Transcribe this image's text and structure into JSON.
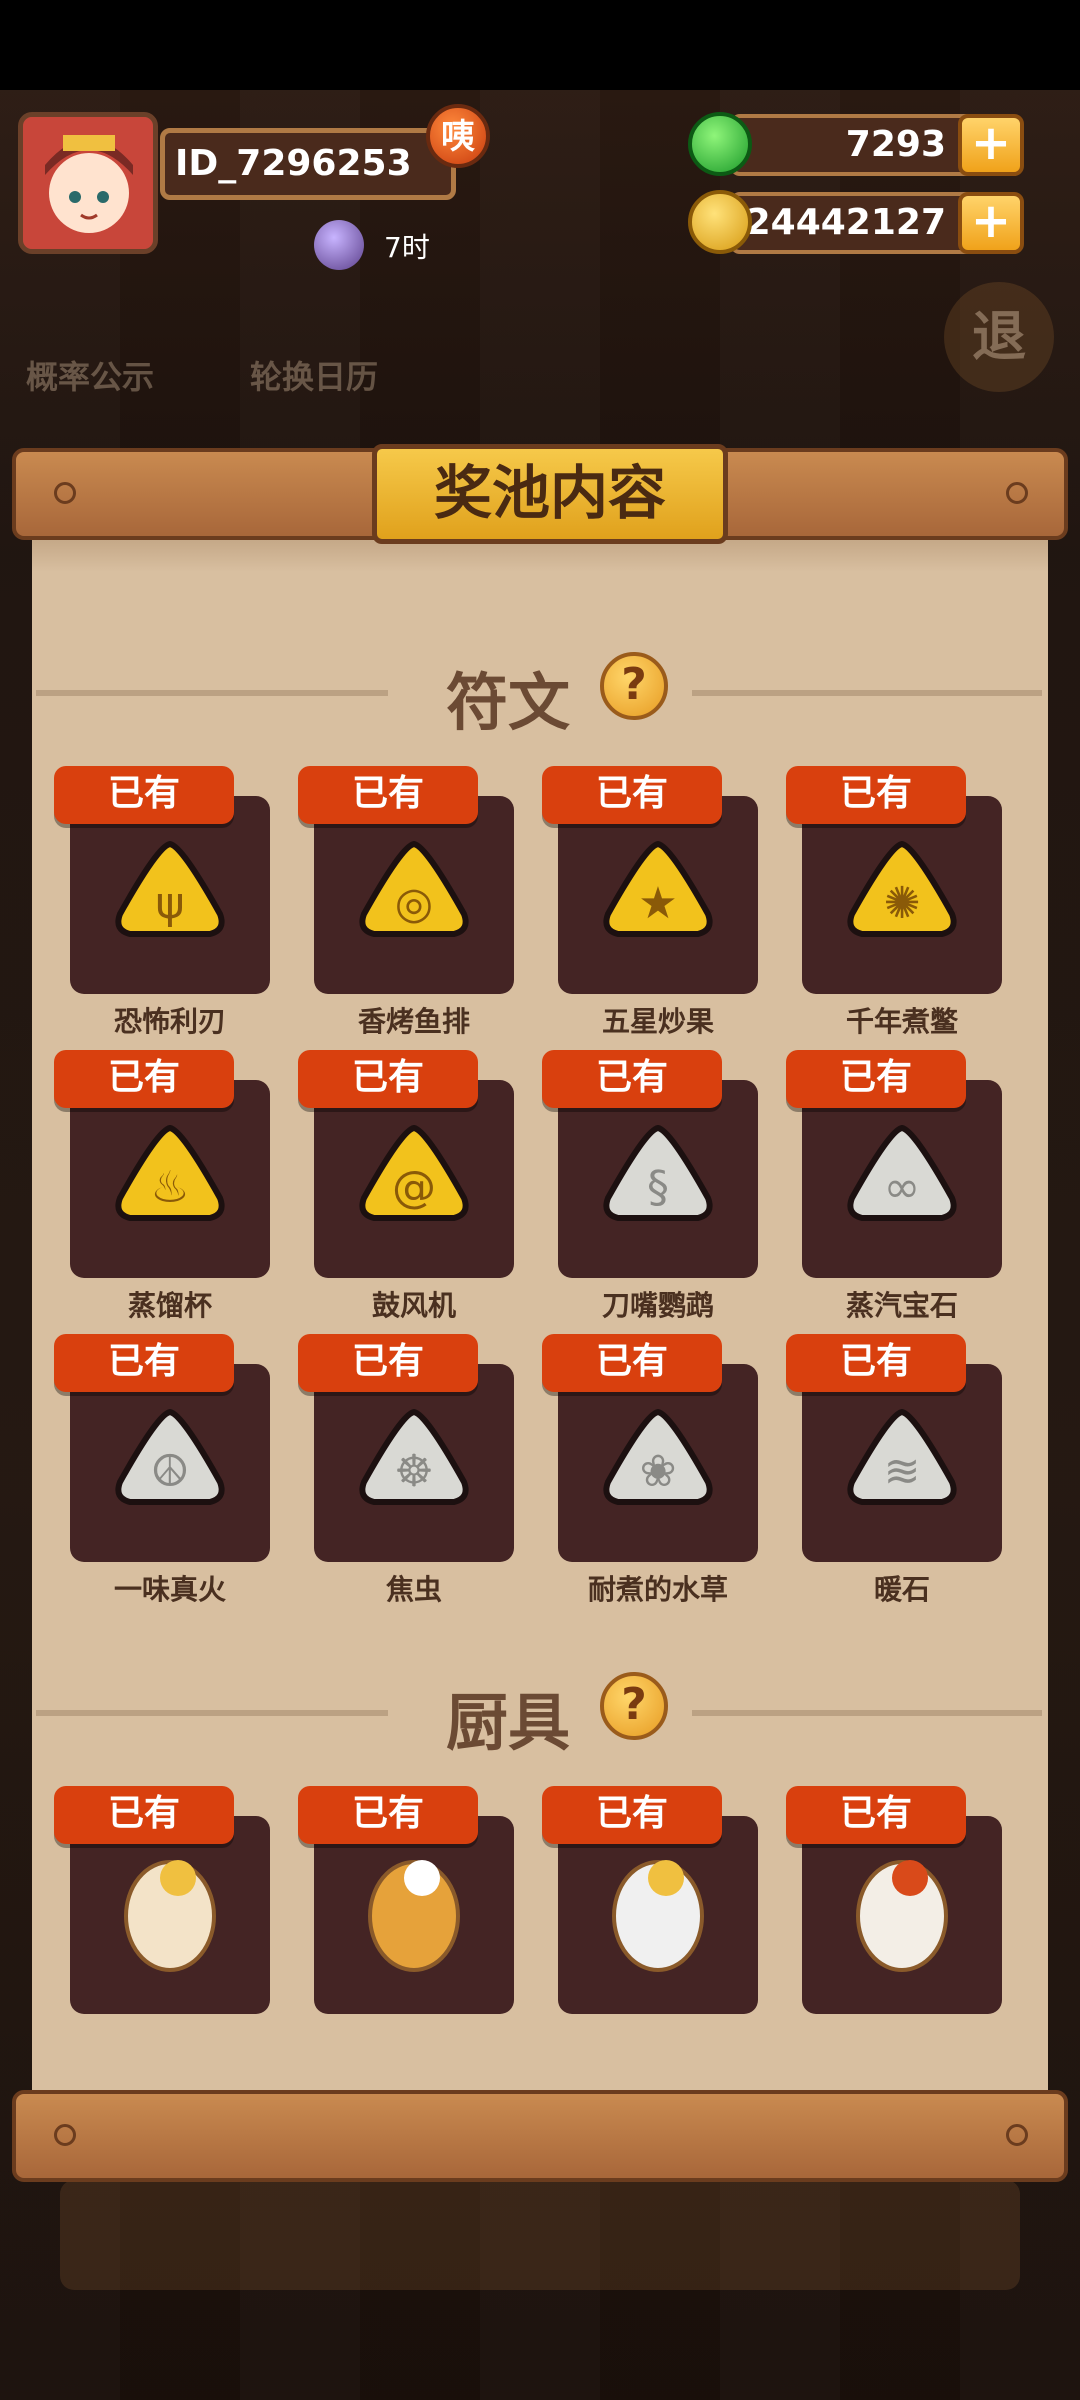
{
  "player": {
    "id": "ID_7296253",
    "badge": "咦",
    "time": "7时"
  },
  "currencies": {
    "jade": "7293",
    "coins": "24442127",
    "plus": "+"
  },
  "background_menu": {
    "rate": "概率公示",
    "calendar": "轮换日历",
    "exit": "退"
  },
  "panel": {
    "title": "奖池内容",
    "owned_tag": "已有",
    "help": "?",
    "sections": [
      {
        "title": "符文",
        "items": [
          {
            "name": "恐怖利刃",
            "tier": "gold",
            "glyph": "ψ"
          },
          {
            "name": "香烤鱼排",
            "tier": "gold",
            "glyph": "◎"
          },
          {
            "name": "五星炒果",
            "tier": "gold",
            "glyph": "★"
          },
          {
            "name": "千年煮鳖",
            "tier": "gold",
            "glyph": "✺"
          },
          {
            "name": "蒸馏杯",
            "tier": "gold",
            "glyph": "♨"
          },
          {
            "name": "鼓风机",
            "tier": "gold",
            "glyph": "@"
          },
          {
            "name": "刀嘴鹦鹉",
            "tier": "silver",
            "glyph": "§"
          },
          {
            "name": "蒸汽宝石",
            "tier": "silver",
            "glyph": "∞"
          },
          {
            "name": "一味真火",
            "tier": "silver",
            "glyph": "☮"
          },
          {
            "name": "焦虫",
            "tier": "silver",
            "glyph": "☸"
          },
          {
            "name": "耐煮的水草",
            "tier": "silver",
            "glyph": "❀"
          },
          {
            "name": "暖石",
            "tier": "silver",
            "glyph": "≋"
          }
        ]
      },
      {
        "title": "厨具",
        "items": [
          {
            "name": "",
            "icon": "dancing-lion-broom-icon"
          },
          {
            "name": "",
            "icon": "phoenix-duster-icon"
          },
          {
            "name": "",
            "icon": "unicorn-ring-icon"
          },
          {
            "name": "",
            "icon": "feather-fan-icon"
          }
        ]
      }
    ]
  },
  "colors": {
    "tag": "#d9400e",
    "card": "#442424",
    "panel": "#d8bfa0",
    "gold_rune": "#f2c21c",
    "silver_rune": "#d9d9d4"
  }
}
